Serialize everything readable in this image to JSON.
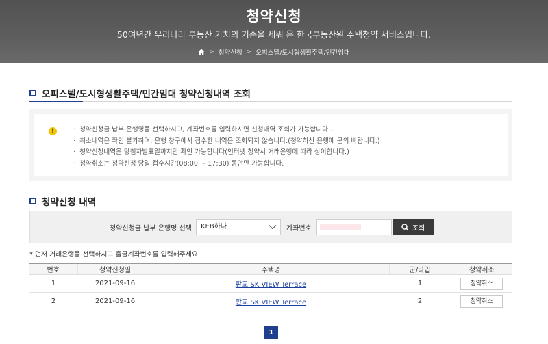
{
  "hero": {
    "title": "청약신청",
    "subtitle": "50여년간 우리나라 부동산 가치의 기준을 세워 온 한국부동산원 주택청약 서비스입니다.",
    "breadcrumb": [
      "청약신청",
      "오피스텔/도시형생활주택/민간임대"
    ]
  },
  "section1": {
    "title": "오피스텔/도시형생활주택/민간임대 청약신청내역 조회"
  },
  "notice": {
    "items": [
      "청약신청금 납부 은행명을 선택하시고, 계좌번호를 입력하시면 신청내역 조회가 가능합니다..",
      "취소내역은 확인 불가하며, 은행 창구에서 접수한 내역은 조회되지 않습니다.(청약하신 은행에 문의 바랍니다.)",
      "청약신청내역은 당첨자발표일까지만 확인 가능합니다(인터넷 청약시 거래은행에 따라 상이합니다.)",
      "청약취소는 청약신청 당일 접수시간(08:00 ~ 17:30) 동안만 가능합니다."
    ]
  },
  "section2": {
    "title": "청약신청 내역"
  },
  "search": {
    "bank_label": "청약신청금 납부 은행명 선택",
    "bank_value": "KEB하나",
    "account_label": "계좌번호",
    "button_label": "조회"
  },
  "hint": "* 먼저 거래은행을 선택하시고 출금계좌번호를 입력해주세요",
  "table": {
    "headers": [
      "번호",
      "청약신청일",
      "주택명",
      "군/타입",
      "청약취소"
    ],
    "rows": [
      {
        "no": "1",
        "date": "2021-09-16",
        "name": "판교 SK VIEW Terrace",
        "type": "1",
        "cancel": "청약취소"
      },
      {
        "no": "2",
        "date": "2021-09-16",
        "name": "판교 SK VIEW Terrace",
        "type": "2",
        "cancel": "청약취소"
      }
    ]
  },
  "pagination": {
    "current": "1"
  }
}
